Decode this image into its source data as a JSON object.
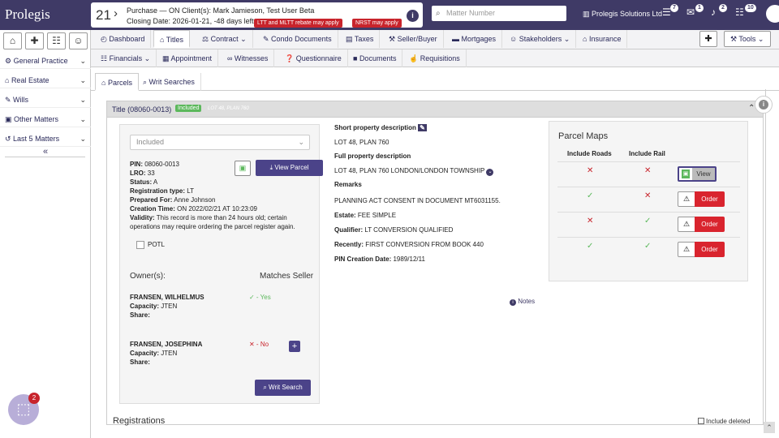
{
  "app": {
    "logo": "Prolegis"
  },
  "matter": {
    "number": "21",
    "title": "Purchase — ON Client(s): Mark Jamieson, Test User Beta",
    "closing": "Closing Date: 2026-01-21, -48 days left",
    "tag1": "LTT and MLTT rebate may apply",
    "tag2": "NRST may apply",
    "info": "i"
  },
  "search": {
    "placeholder": "Matter Number"
  },
  "header": {
    "company": "Prolegis Solutions Ltd",
    "badges": {
      "tasks": "7",
      "mail": "1",
      "bell": "2",
      "docs": "10"
    }
  },
  "sidebar": {
    "items": [
      {
        "label": "General Practice"
      },
      {
        "label": "Real Estate"
      },
      {
        "label": "Wills"
      },
      {
        "label": "Other Matters"
      },
      {
        "label": "Last 5 Matters"
      }
    ],
    "collapse": "«"
  },
  "chat": {
    "badge": "2"
  },
  "tabs": {
    "row1": [
      "Dashboard",
      "Titles",
      "Contract",
      "Condo Documents",
      "Taxes",
      "Seller/Buyer",
      "Mortgages",
      "Stakeholders",
      "Insurance"
    ],
    "row2": [
      "Financials",
      "Appointment",
      "Witnesses",
      "Questionnaire",
      "Documents",
      "Requisitions"
    ],
    "tools": "Tools"
  },
  "subtabs": {
    "parcels": "Parcels",
    "writ": "Writ Searches"
  },
  "panel": {
    "title": "Title (08060-0013)",
    "badge": "Included",
    "lot_small": "LOT 48, PLAN 760"
  },
  "parcel": {
    "select": "Included",
    "view_parcel": "View Parcel",
    "pin": "08060-0013",
    "lro": "33",
    "status": "A",
    "reg_type": "LT",
    "prepared_for": "Anne Johnson",
    "creation_time": "ON 2022/02/21 AT 10:23:09",
    "validity_1": "This record is more than 24 hours old; certain",
    "validity_2": "operations may require ordering the parcel register again.",
    "potl": "POTL",
    "labels": {
      "pin": "PIN:",
      "lro": "LRO:",
      "status": "Status:",
      "reg": "Registration type:",
      "prep": "Prepared For:",
      "created": "Creation Time:",
      "validity": "Validity:"
    }
  },
  "owners": {
    "label": "Owner(s):",
    "matches": "Matches Seller",
    "list": [
      {
        "name": "FRANSEN, WILHELMUS",
        "capacity": "JTEN",
        "match": "✓ - Yes"
      },
      {
        "name": "FRANSEN, JOSEPHINA",
        "capacity": "JTEN",
        "match": "✕ - No"
      }
    ],
    "capacity_label": "Capacity:",
    "share_label": "Share:",
    "writ_search": "Writ Search"
  },
  "details": {
    "short_head": "Short property description",
    "short": "LOT 48, PLAN 760",
    "full_head": "Full property description",
    "full": "LOT 48, PLAN 760 LONDON/LONDON TOWNSHIP",
    "remarks_head": "Remarks",
    "remarks": "PLANNING ACT CONSENT IN DOCUMENT MT6031155.",
    "estate_label": "Estate:",
    "estate": "FEE SIMPLE",
    "qualifier_label": "Qualifier:",
    "qualifier": "LT CONVERSION QUALIFIED",
    "recently_label": "Recently:",
    "recently": "FIRST CONVERSION FROM BOOK 440",
    "pin_created_label": "PIN Creation Date:",
    "pin_created": "1989/12/11",
    "notes": "Notes"
  },
  "maps": {
    "title": "Parcel Maps",
    "col_roads": "Include Roads",
    "col_rail": "Include Rail",
    "view": "View",
    "order": "Order"
  },
  "footer": {
    "registrations": "Registrations",
    "include_deleted": "Include deleted"
  }
}
